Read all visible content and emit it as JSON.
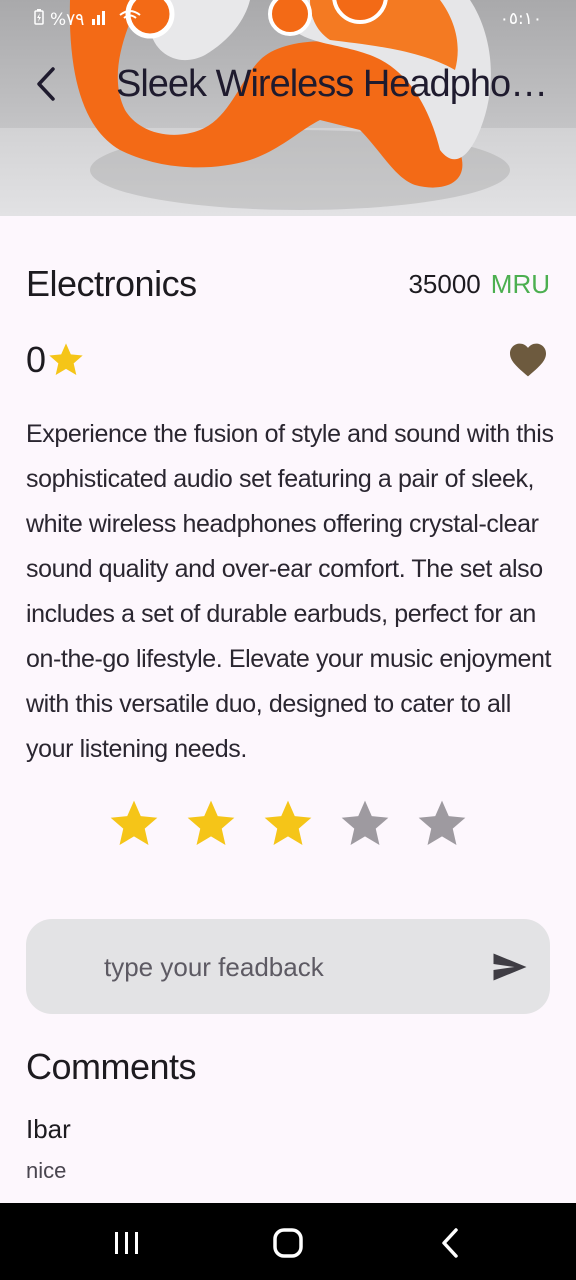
{
  "status_bar": {
    "battery": "%٧٩",
    "time": "٠٥:١٠"
  },
  "header": {
    "title": "Sleek Wireless Headphone & Ear Buds",
    "back_icon": "back-arrow-icon"
  },
  "product": {
    "category": "Electronics",
    "price": "35000",
    "currency": "MRU",
    "rating_count": "0",
    "favorite_icon": "heart-icon",
    "description": "Experience the fusion of style and sound with this sophisticated audio set featuring a pair of sleek, white wireless headphones offering crystal-clear sound quality and over-ear comfort. The set also includes a set of durable earbuds, perfect for an on-the-go lifestyle. Elevate your music enjoyment with this versatile duo, designed to cater to all your listening needs."
  },
  "rating_input": {
    "selected": 3,
    "max": 5
  },
  "feedback": {
    "placeholder": "type your feadback",
    "value": "",
    "send_icon": "send-icon"
  },
  "comments": {
    "title": "Comments",
    "items": [
      {
        "author": "Ibar",
        "text": "nice"
      }
    ]
  },
  "colors": {
    "background": "#fdf7fd",
    "star_filled": "#f5c518",
    "star_empty": "#9e9aa0",
    "heart": "#6d5a3e",
    "price_currency": "#4caf50",
    "input_background": "#e3e3e5"
  }
}
